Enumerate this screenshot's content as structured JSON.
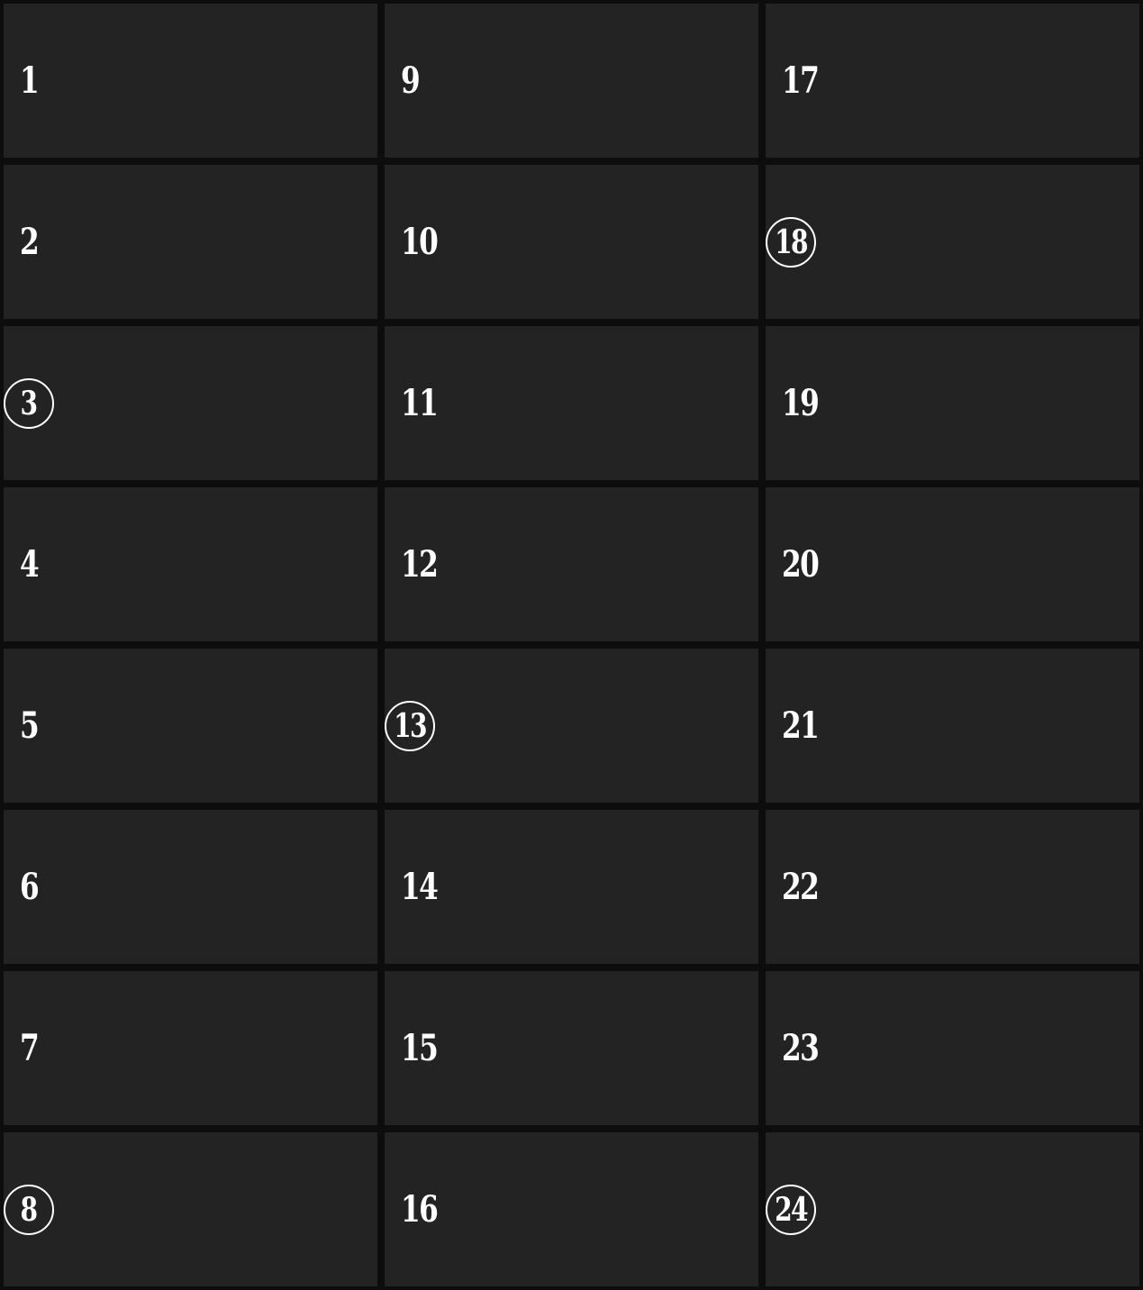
{
  "grid": {
    "columns": 3,
    "rows": 8,
    "cells": [
      {
        "label": "1",
        "circled": false
      },
      {
        "label": "2",
        "circled": false
      },
      {
        "label": "3",
        "circled": true
      },
      {
        "label": "4",
        "circled": false
      },
      {
        "label": "5",
        "circled": false
      },
      {
        "label": "6",
        "circled": false
      },
      {
        "label": "7",
        "circled": false
      },
      {
        "label": "8",
        "circled": true
      },
      {
        "label": "9",
        "circled": false
      },
      {
        "label": "10",
        "circled": false
      },
      {
        "label": "11",
        "circled": false
      },
      {
        "label": "12",
        "circled": false
      },
      {
        "label": "13",
        "circled": true
      },
      {
        "label": "14",
        "circled": false
      },
      {
        "label": "15",
        "circled": false
      },
      {
        "label": "16",
        "circled": false
      },
      {
        "label": "17",
        "circled": false
      },
      {
        "label": "18",
        "circled": true
      },
      {
        "label": "19",
        "circled": false
      },
      {
        "label": "20",
        "circled": false
      },
      {
        "label": "21",
        "circled": false
      },
      {
        "label": "22",
        "circled": false
      },
      {
        "label": "23",
        "circled": false
      },
      {
        "label": "24",
        "circled": true
      }
    ]
  },
  "colors": {
    "background": "#0d0d0d",
    "cell": "#232323",
    "text": "#ffffff"
  }
}
